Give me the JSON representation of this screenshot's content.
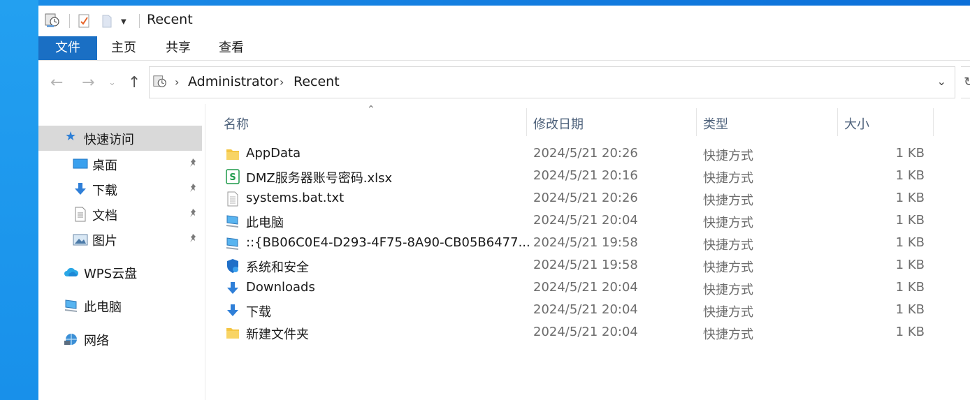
{
  "window": {
    "title": "Recent"
  },
  "ribbon": {
    "tabs": [
      "文件",
      "主页",
      "共享",
      "查看"
    ]
  },
  "address": {
    "crumbs": [
      "Administrator",
      "Recent"
    ]
  },
  "navpane": {
    "quick_access": "快速访问",
    "pinned": [
      {
        "label": "桌面",
        "icon": "desktop-icon"
      },
      {
        "label": "下载",
        "icon": "download-icon"
      },
      {
        "label": "文档",
        "icon": "document-icon"
      },
      {
        "label": "图片",
        "icon": "picture-icon"
      }
    ],
    "wps": "WPS云盘",
    "this_pc": "此电脑",
    "network": "网络"
  },
  "columns": {
    "name": "名称",
    "date": "修改日期",
    "type": "类型",
    "size": "大小"
  },
  "files": [
    {
      "name": "AppData",
      "date": "2024/5/21 20:26",
      "type": "快捷方式",
      "size": "1 KB",
      "icon": "folder-icon"
    },
    {
      "name": "DMZ服务器账号密码.xlsx",
      "date": "2024/5/21 20:16",
      "type": "快捷方式",
      "size": "1 KB",
      "icon": "spreadsheet-icon"
    },
    {
      "name": "systems.bat.txt",
      "date": "2024/5/21 20:26",
      "type": "快捷方式",
      "size": "1 KB",
      "icon": "text-file-icon"
    },
    {
      "name": "此电脑",
      "date": "2024/5/21 20:04",
      "type": "快捷方式",
      "size": "1 KB",
      "icon": "computer-icon"
    },
    {
      "name": "::{BB06C0E4-D293-4F75-8A90-CB05B6477...",
      "date": "2024/5/21 19:58",
      "type": "快捷方式",
      "size": "1 KB",
      "icon": "computer-icon"
    },
    {
      "name": "系统和安全",
      "date": "2024/5/21 19:58",
      "type": "快捷方式",
      "size": "1 KB",
      "icon": "shield-icon"
    },
    {
      "name": "Downloads",
      "date": "2024/5/21 20:04",
      "type": "快捷方式",
      "size": "1 KB",
      "icon": "download-icon"
    },
    {
      "name": "下载",
      "date": "2024/5/21 20:04",
      "type": "快捷方式",
      "size": "1 KB",
      "icon": "download-icon"
    },
    {
      "name": "新建文件夹",
      "date": "2024/5/21 20:04",
      "type": "快捷方式",
      "size": "1 KB",
      "icon": "folder-icon"
    }
  ],
  "colors": {
    "file_tab": "#1a6fc4",
    "selected_nav": "#d9d9d9",
    "header_text": "#4c607a",
    "meta_text": "#6d6d6d",
    "folder": "#f4c542",
    "download_arrow": "#2f7fd8"
  }
}
